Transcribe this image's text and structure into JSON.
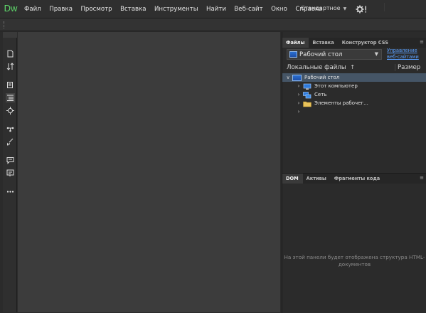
{
  "app": {
    "logo_text": "Dw"
  },
  "menu": [
    "Файл",
    "Правка",
    "Просмотр",
    "Вставка",
    "Инструменты",
    "Найти",
    "Веб-сайт",
    "Окно",
    "Справка"
  ],
  "workspace_label": "Стандартное",
  "files_panel": {
    "tabs": [
      "Файлы",
      "Вставка",
      "Конструктор CSS"
    ],
    "site_selector": "Рабочий стол",
    "manage_link": "Управление веб-сайтами",
    "local_files_header": "Локальные файлы",
    "size_header": "Размер",
    "tree": [
      {
        "label": "Рабочий стол",
        "selected": true,
        "icon": "desktop-icon"
      },
      {
        "label": "Этот компьютер",
        "icon": "computer-icon"
      },
      {
        "label": "Сеть",
        "icon": "network-icon"
      },
      {
        "label": "Элементы рабочег...",
        "icon": "folder-icon"
      }
    ]
  },
  "dom_panel": {
    "tabs": [
      "DOM",
      "Активы",
      "Фрагменты кода"
    ],
    "empty_message": "На этой панели будет отображена структура HTML-документов"
  },
  "colors": {
    "accent_link": "#5aa0ff",
    "selection": "#455566",
    "logo": "#5fd96b"
  }
}
